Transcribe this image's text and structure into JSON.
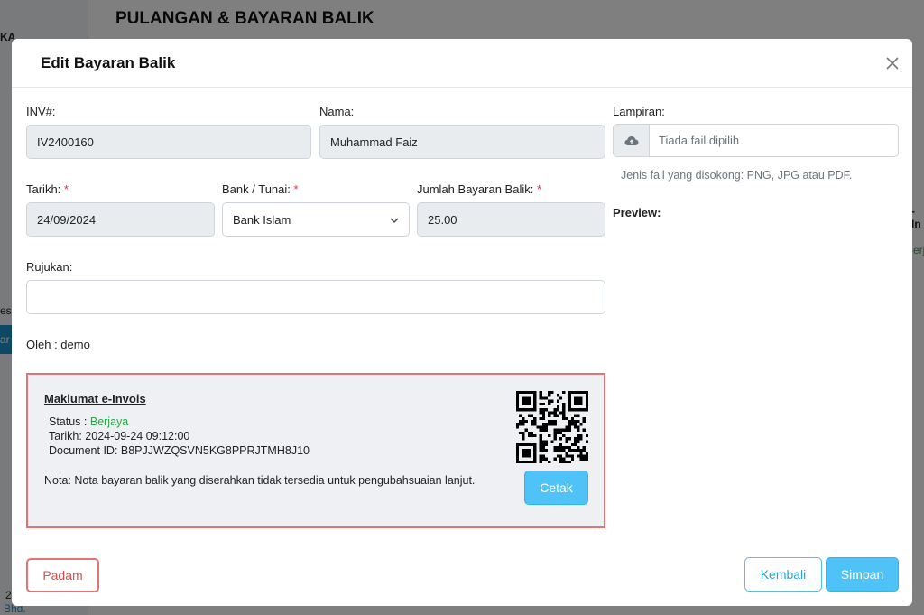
{
  "background": {
    "page_title": "PULANGAN & BAYARAN BALIK",
    "sidebar_fragment_1": "KA",
    "sidebar_fragment_2": "esi",
    "sidebar_fragment_3": "ar",
    "sidebar_fragment_4": "2",
    "sidebar_fragment_5": "Bhd.",
    "right_fragment_1": "-In",
    "right_fragment_2": "erja"
  },
  "modal": {
    "title": "Edit Bayaran Balik",
    "inv": {
      "label": "INV#:",
      "value": "IV2400160"
    },
    "nama": {
      "label": "Nama:",
      "value": "Muhammad Faiz"
    },
    "lampiran": {
      "label": "Lampiran:",
      "file_text": "Tiada fail dipilih",
      "hint": "Jenis fail yang disokong: PNG, JPG atau PDF.",
      "preview_label": "Preview:"
    },
    "tarikh": {
      "label": "Tarikh:",
      "required": "*",
      "value": "24/09/2024"
    },
    "bank": {
      "label": "Bank / Tunai:",
      "required": "*",
      "value": "Bank Islam"
    },
    "jumlah": {
      "label": "Jumlah Bayaran Balik:",
      "required": "*",
      "value": "25.00"
    },
    "rujukan": {
      "label": "Rujukan:",
      "value": ""
    },
    "oleh": "Oleh : demo",
    "einvoice": {
      "title": "Maklumat e-Invois",
      "status_label": "Status : ",
      "status_value": "Berjaya",
      "tarikh": "Tarikh: 2024-09-24 09:12:00",
      "document_id": "Document ID: B8PJJWZQSVN5KG8PPRJTMH8J10",
      "note": "Nota: Nota bayaran balik yang diserahkan tidak tersedia untuk pengubahsuaian lanjut.",
      "print_button": "Cetak"
    },
    "buttons": {
      "delete": "Padam",
      "back": "Kembali",
      "save": "Simpan"
    }
  },
  "colors": {
    "accent": "#4fc3f7",
    "danger": "#e57373",
    "success": "#28a745"
  }
}
